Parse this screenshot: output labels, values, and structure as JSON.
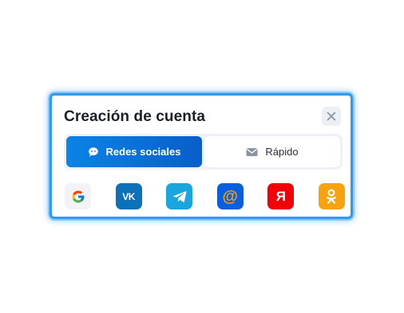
{
  "modal": {
    "title": "Creación de cuenta",
    "close_icon": "close-icon"
  },
  "tabs": [
    {
      "label": "Redes sociales",
      "icon": "chat-bubble-icon",
      "active": true
    },
    {
      "label": "Rápido",
      "icon": "envelope-icon",
      "active": false
    }
  ],
  "social_buttons": [
    {
      "name": "google",
      "icon": "google-icon",
      "color": "#f1f3f6"
    },
    {
      "name": "vk",
      "icon": "vk-icon",
      "glyph": "VK",
      "color": "#0c71b8"
    },
    {
      "name": "telegram",
      "icon": "telegram-icon",
      "color": "#1aa5df"
    },
    {
      "name": "mail",
      "icon": "at-sign-icon",
      "glyph": "@",
      "color": "#0a5fe0"
    },
    {
      "name": "yandex",
      "icon": "yandex-icon",
      "glyph": "Я",
      "color": "#f2000a"
    },
    {
      "name": "odnoklassniki",
      "icon": "odnoklassniki-icon",
      "color": "#f7a20f"
    }
  ],
  "colors": {
    "accent": "#0a84e6",
    "modal_border": "#2d9bf0"
  }
}
